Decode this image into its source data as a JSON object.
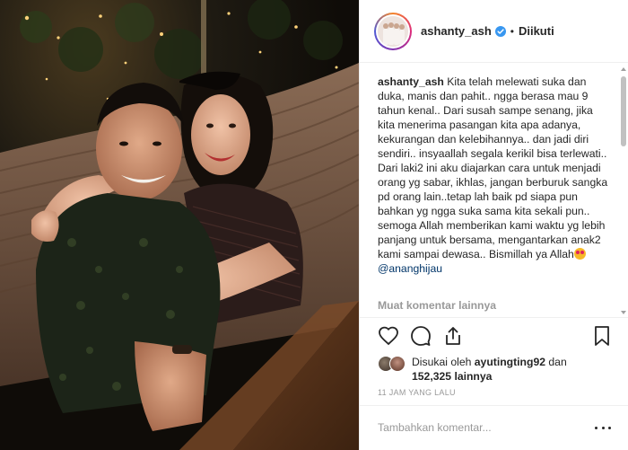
{
  "post": {
    "username": "ashanty_ash",
    "separator": "•",
    "follow_status": "Diikuti",
    "caption": {
      "username": "ashanty_ash",
      "text": "Kita telah melewati suka dan duka, manis dan pahit.. ngga berasa mau 9 tahun kenal.. Dari susah sampe senang, jika kita menerima pasangan kita apa adanya, kekurangan dan kelebihannya.. dan jadi diri sendiri.. insyaallah segala kerikil bisa terlewati.. Dari laki2 ini aku diajarkan cara untuk menjadi orang yg sabar, ikhlas, jangan berburuk sangka pd orang lain..tetap lah baik pd siapa pun bahkan yg ngga suka sama kita sekali pun.. semoga Allah memberikan kami waktu yg lebih panjang untuk bersama, mengantarkan anak2 kami sampai dewasa.. Bismillah ya Allah",
      "mention": "@ananghijau"
    },
    "load_more_comments": "Muat komentar lainnya",
    "likes": {
      "prefix": "Disukai oleh",
      "liker": "ayutingting92",
      "conjunction": "dan",
      "others": "152,325 lainnya"
    },
    "timestamp": "11 JAM YANG LALU",
    "comment_placeholder": "Tambahkan komentar..."
  },
  "icons": {
    "verified": "verified-badge-icon",
    "like": "heart-icon",
    "comment": "comment-bubble-icon",
    "share": "share-icon",
    "save": "bookmark-icon",
    "more": "more-options-icon"
  },
  "colors": {
    "verified_blue": "#3897f0",
    "text_primary": "#262626",
    "text_muted": "#999999",
    "mention": "#003569",
    "border": "#efefef"
  }
}
